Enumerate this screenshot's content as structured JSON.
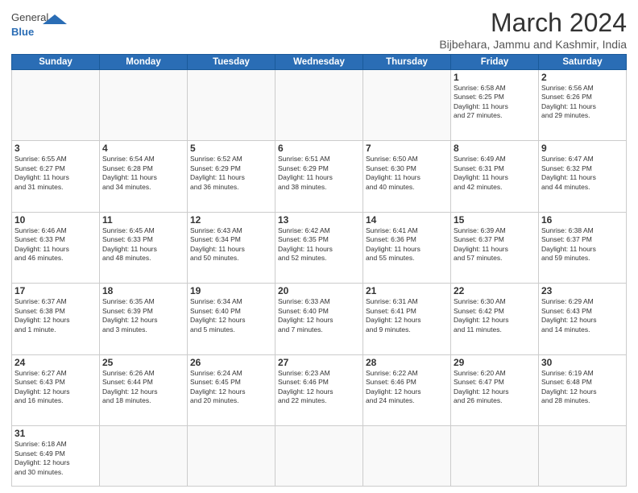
{
  "header": {
    "logo_general": "General",
    "logo_blue": "Blue",
    "month_title": "March 2024",
    "subtitle": "Bijbehara, Jammu and Kashmir, India"
  },
  "days_of_week": [
    "Sunday",
    "Monday",
    "Tuesday",
    "Wednesday",
    "Thursday",
    "Friday",
    "Saturday"
  ],
  "weeks": [
    [
      {
        "day": "",
        "info": ""
      },
      {
        "day": "",
        "info": ""
      },
      {
        "day": "",
        "info": ""
      },
      {
        "day": "",
        "info": ""
      },
      {
        "day": "",
        "info": ""
      },
      {
        "day": "1",
        "info": "Sunrise: 6:58 AM\nSunset: 6:25 PM\nDaylight: 11 hours\nand 27 minutes."
      },
      {
        "day": "2",
        "info": "Sunrise: 6:56 AM\nSunset: 6:26 PM\nDaylight: 11 hours\nand 29 minutes."
      }
    ],
    [
      {
        "day": "3",
        "info": "Sunrise: 6:55 AM\nSunset: 6:27 PM\nDaylight: 11 hours\nand 31 minutes."
      },
      {
        "day": "4",
        "info": "Sunrise: 6:54 AM\nSunset: 6:28 PM\nDaylight: 11 hours\nand 34 minutes."
      },
      {
        "day": "5",
        "info": "Sunrise: 6:52 AM\nSunset: 6:29 PM\nDaylight: 11 hours\nand 36 minutes."
      },
      {
        "day": "6",
        "info": "Sunrise: 6:51 AM\nSunset: 6:29 PM\nDaylight: 11 hours\nand 38 minutes."
      },
      {
        "day": "7",
        "info": "Sunrise: 6:50 AM\nSunset: 6:30 PM\nDaylight: 11 hours\nand 40 minutes."
      },
      {
        "day": "8",
        "info": "Sunrise: 6:49 AM\nSunset: 6:31 PM\nDaylight: 11 hours\nand 42 minutes."
      },
      {
        "day": "9",
        "info": "Sunrise: 6:47 AM\nSunset: 6:32 PM\nDaylight: 11 hours\nand 44 minutes."
      }
    ],
    [
      {
        "day": "10",
        "info": "Sunrise: 6:46 AM\nSunset: 6:33 PM\nDaylight: 11 hours\nand 46 minutes."
      },
      {
        "day": "11",
        "info": "Sunrise: 6:45 AM\nSunset: 6:33 PM\nDaylight: 11 hours\nand 48 minutes."
      },
      {
        "day": "12",
        "info": "Sunrise: 6:43 AM\nSunset: 6:34 PM\nDaylight: 11 hours\nand 50 minutes."
      },
      {
        "day": "13",
        "info": "Sunrise: 6:42 AM\nSunset: 6:35 PM\nDaylight: 11 hours\nand 52 minutes."
      },
      {
        "day": "14",
        "info": "Sunrise: 6:41 AM\nSunset: 6:36 PM\nDaylight: 11 hours\nand 55 minutes."
      },
      {
        "day": "15",
        "info": "Sunrise: 6:39 AM\nSunset: 6:37 PM\nDaylight: 11 hours\nand 57 minutes."
      },
      {
        "day": "16",
        "info": "Sunrise: 6:38 AM\nSunset: 6:37 PM\nDaylight: 11 hours\nand 59 minutes."
      }
    ],
    [
      {
        "day": "17",
        "info": "Sunrise: 6:37 AM\nSunset: 6:38 PM\nDaylight: 12 hours\nand 1 minute."
      },
      {
        "day": "18",
        "info": "Sunrise: 6:35 AM\nSunset: 6:39 PM\nDaylight: 12 hours\nand 3 minutes."
      },
      {
        "day": "19",
        "info": "Sunrise: 6:34 AM\nSunset: 6:40 PM\nDaylight: 12 hours\nand 5 minutes."
      },
      {
        "day": "20",
        "info": "Sunrise: 6:33 AM\nSunset: 6:40 PM\nDaylight: 12 hours\nand 7 minutes."
      },
      {
        "day": "21",
        "info": "Sunrise: 6:31 AM\nSunset: 6:41 PM\nDaylight: 12 hours\nand 9 minutes."
      },
      {
        "day": "22",
        "info": "Sunrise: 6:30 AM\nSunset: 6:42 PM\nDaylight: 12 hours\nand 11 minutes."
      },
      {
        "day": "23",
        "info": "Sunrise: 6:29 AM\nSunset: 6:43 PM\nDaylight: 12 hours\nand 14 minutes."
      }
    ],
    [
      {
        "day": "24",
        "info": "Sunrise: 6:27 AM\nSunset: 6:43 PM\nDaylight: 12 hours\nand 16 minutes."
      },
      {
        "day": "25",
        "info": "Sunrise: 6:26 AM\nSunset: 6:44 PM\nDaylight: 12 hours\nand 18 minutes."
      },
      {
        "day": "26",
        "info": "Sunrise: 6:24 AM\nSunset: 6:45 PM\nDaylight: 12 hours\nand 20 minutes."
      },
      {
        "day": "27",
        "info": "Sunrise: 6:23 AM\nSunset: 6:46 PM\nDaylight: 12 hours\nand 22 minutes."
      },
      {
        "day": "28",
        "info": "Sunrise: 6:22 AM\nSunset: 6:46 PM\nDaylight: 12 hours\nand 24 minutes."
      },
      {
        "day": "29",
        "info": "Sunrise: 6:20 AM\nSunset: 6:47 PM\nDaylight: 12 hours\nand 26 minutes."
      },
      {
        "day": "30",
        "info": "Sunrise: 6:19 AM\nSunset: 6:48 PM\nDaylight: 12 hours\nand 28 minutes."
      }
    ],
    [
      {
        "day": "31",
        "info": "Sunrise: 6:18 AM\nSunset: 6:49 PM\nDaylight: 12 hours\nand 30 minutes."
      },
      {
        "day": "",
        "info": ""
      },
      {
        "day": "",
        "info": ""
      },
      {
        "day": "",
        "info": ""
      },
      {
        "day": "",
        "info": ""
      },
      {
        "day": "",
        "info": ""
      },
      {
        "day": "",
        "info": ""
      }
    ]
  ]
}
